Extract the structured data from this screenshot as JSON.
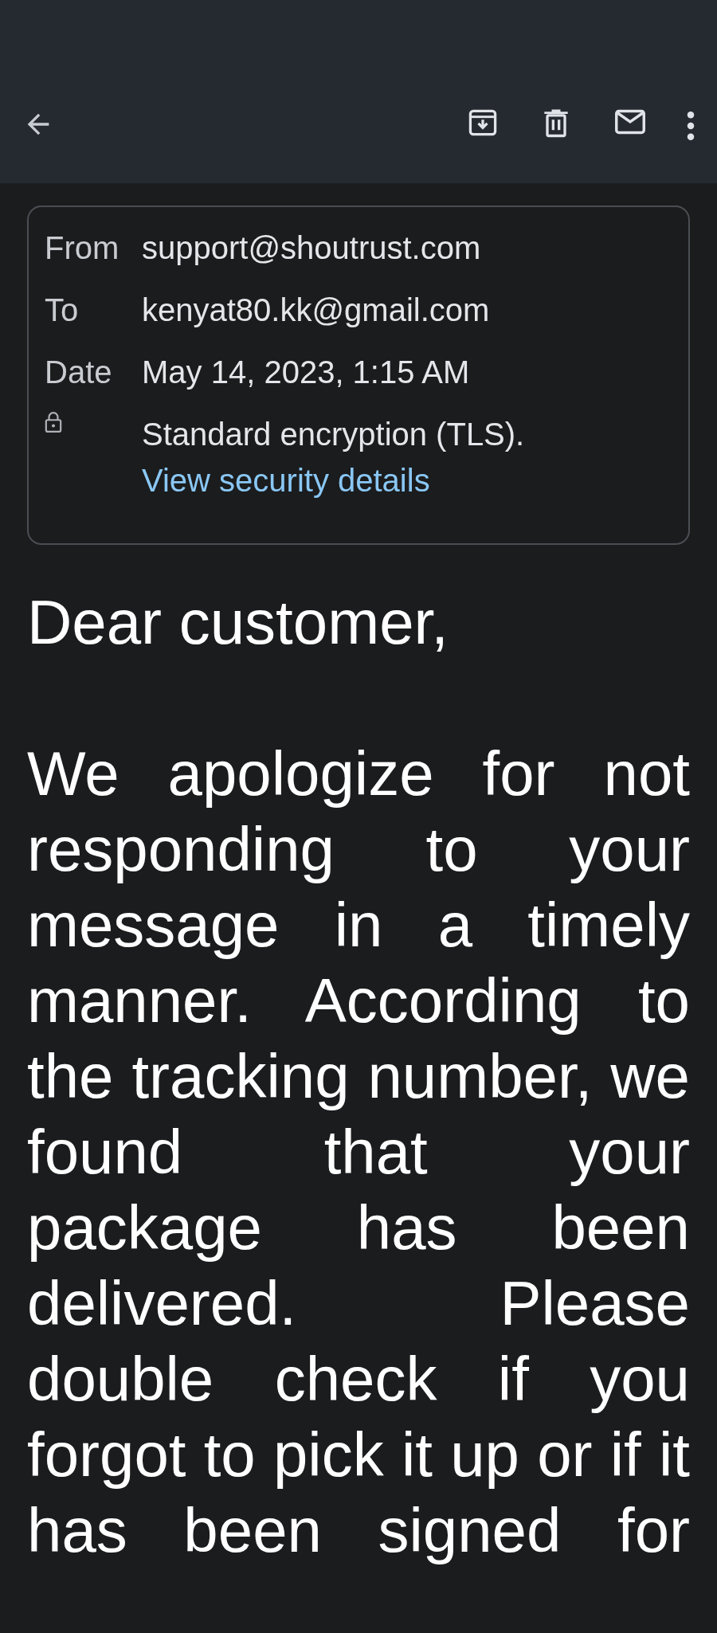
{
  "toolbar": {
    "actions": [
      {
        "kind": "archive"
      },
      {
        "kind": "delete"
      },
      {
        "kind": "mark-unread"
      },
      {
        "kind": "more"
      }
    ]
  },
  "details": {
    "rows": [
      {
        "kind": "field",
        "label": "From",
        "value": "support@shoutrust.com"
      },
      {
        "kind": "field",
        "label": "To",
        "value": "kenyat80.kk@gmail.com"
      },
      {
        "kind": "field",
        "label": "Date",
        "value": "May 14, 2023, 1:15 AM"
      },
      {
        "kind": "security",
        "value": "Standard encryption (TLS).",
        "link": "View security details"
      }
    ]
  },
  "body": {
    "paragraphs": [
      "Dear customer,",
      "We apologize for not responding to your message in a timely manner. According to the tracking number, we found that your package has been delivered. Please double check if you forgot to pick it up or if it has been signed for"
    ]
  }
}
